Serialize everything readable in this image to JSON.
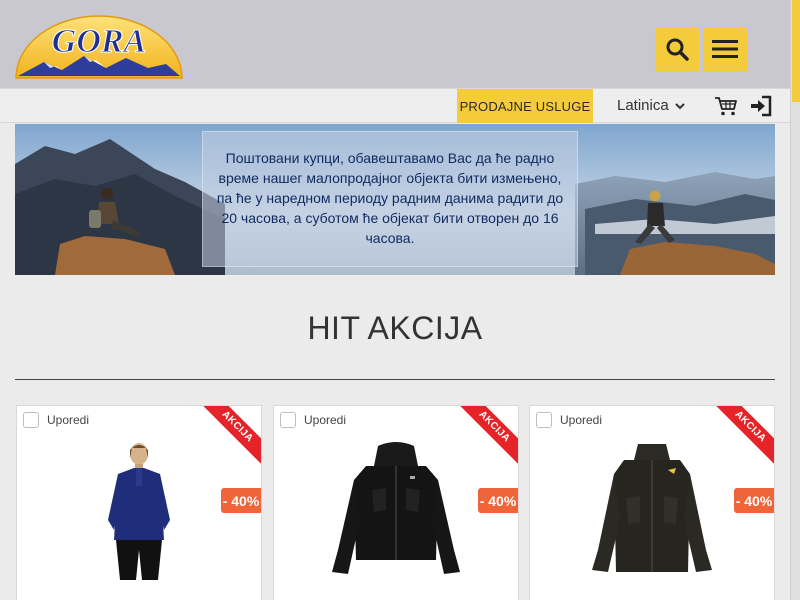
{
  "header": {
    "logo_text": "GORA",
    "search_icon": "search-icon",
    "menu_icon": "hamburger-menu-icon"
  },
  "subbar": {
    "sales_label": "PRODAJNE USLUGE",
    "language": "Latinica",
    "cart_icon": "cart-icon",
    "login_icon": "login-icon"
  },
  "banner": {
    "notice": "Поштовани купци, обавештавамо Вас да ће радно време нашег малопродајног објекта бити измењено, па ће у наредном периоду радним данима радити до 20 часова, а суботом ће објекат бити отворен до 16 часова."
  },
  "section": {
    "title": "HIT AKCIJA"
  },
  "products": [
    {
      "compare_label": "Uporedi",
      "ribbon": "AKCIJA",
      "discount": "- 40%"
    },
    {
      "compare_label": "Uporedi",
      "ribbon": "AKCIJA",
      "discount": "- 40%"
    },
    {
      "compare_label": "Uporedi",
      "ribbon": "AKCIJA",
      "discount": "- 40%"
    }
  ],
  "colors": {
    "accent": "#f4cb3a",
    "header_bg": "#c9c7d0",
    "ribbon": "#e7232a",
    "discount": "#f0643a"
  }
}
